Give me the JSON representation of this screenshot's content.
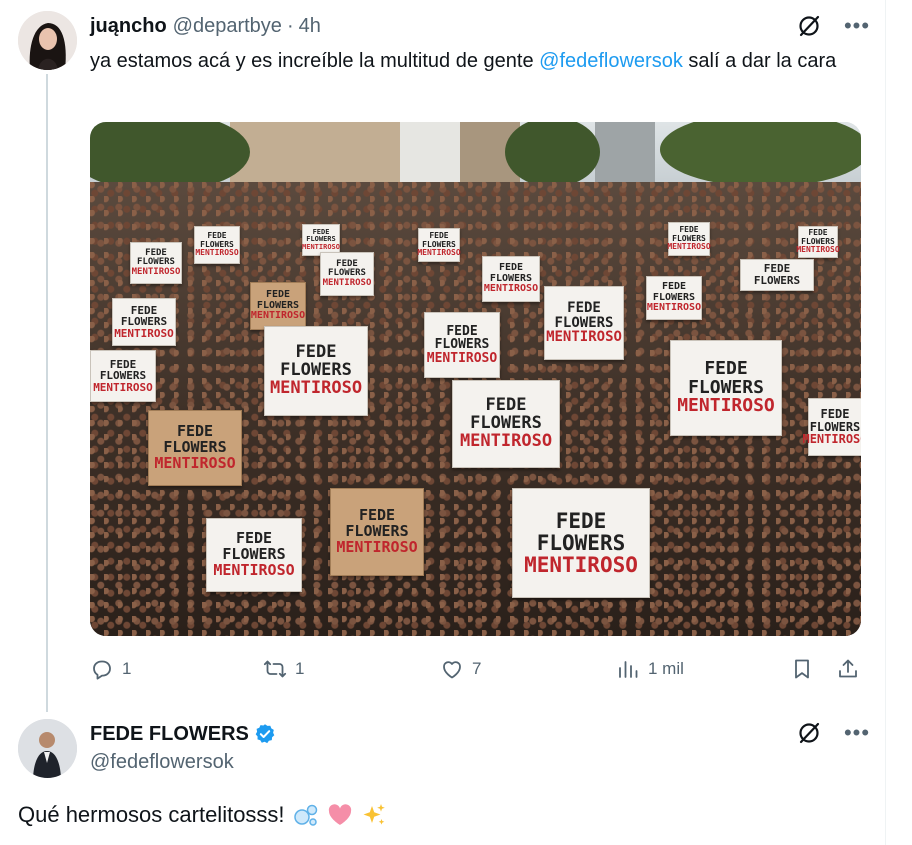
{
  "tweet1": {
    "author_name": "juąncho",
    "author_handle": "@departbye",
    "separator": "·",
    "time": "4h",
    "text_before_mention": "ya estamos acá y es increíble la multitud de gente ",
    "mention": "@fedeflowersok",
    "text_after_mention": " salí a dar la cara",
    "photo": {
      "sign_line1": "FEDE",
      "sign_line2": "FLOWERS",
      "sign_line3": "MENTIROSO"
    },
    "actions": {
      "replies": "1",
      "reposts": "1",
      "likes": "7",
      "views": "1 mil"
    }
  },
  "tweet2": {
    "author_name": "FEDE FLOWERS",
    "author_handle": "@fedeflowersok",
    "text": "Qué hermosos cartelitosss!"
  },
  "colors": {
    "accent": "#1d9bf0",
    "secondary_text": "#536471",
    "primary_text": "#0f1419",
    "verified": "#1d9bf0",
    "thread_line": "#cfd9de"
  },
  "icons": [
    "grok-icon",
    "more-icon",
    "reply-icon",
    "repost-icon",
    "like-icon",
    "views-icon",
    "bookmark-icon",
    "share-icon",
    "verified-badge-icon"
  ]
}
